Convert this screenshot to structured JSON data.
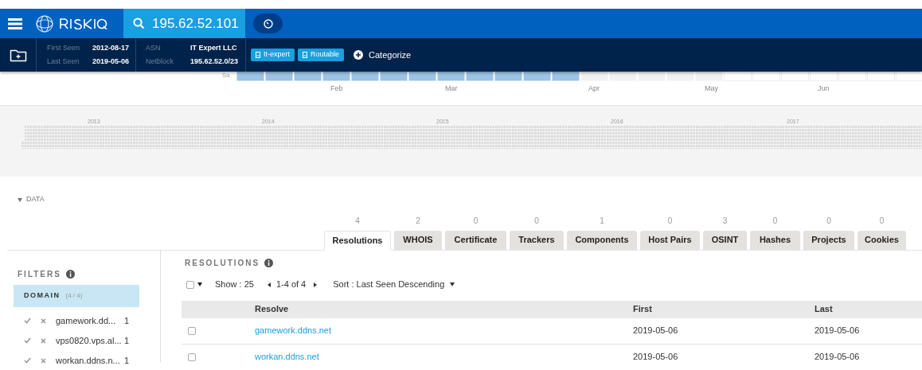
{
  "header": {
    "search_value": "195.62.52.101"
  },
  "summary": {
    "first_seen_label": "First Seen",
    "first_seen": "2012-08-17",
    "last_seen_label": "Last Seen",
    "last_seen": "2019-05-06",
    "asn_label": "ASN",
    "asn": "IT Expert LLC",
    "netblock_label": "Netblock",
    "netblock": "195.62.52.0/23",
    "tags": [
      "It-expert",
      "Routable"
    ],
    "categorize": "Categorize"
  },
  "calendar": {
    "day_label": "Sa",
    "months": [
      "Feb",
      "Mar",
      "Apr",
      "May",
      "Jun"
    ]
  },
  "timeline": {
    "years": [
      "2013",
      "2014",
      "2015",
      "2016",
      "2017"
    ]
  },
  "data_section": {
    "title": "DATA",
    "expanded": true
  },
  "tabs": [
    {
      "label": "Resolutions",
      "count": "4",
      "selected": true
    },
    {
      "label": "WHOIS",
      "count": "2",
      "selected": false
    },
    {
      "label": "Certificate",
      "count": "0",
      "selected": false
    },
    {
      "label": "Trackers",
      "count": "0",
      "selected": false
    },
    {
      "label": "Components",
      "count": "1",
      "selected": false
    },
    {
      "label": "Host Pairs",
      "count": "0",
      "selected": false
    },
    {
      "label": "OSINT",
      "count": "3",
      "selected": false
    },
    {
      "label": "Hashes",
      "count": "0",
      "selected": false
    },
    {
      "label": "Projects",
      "count": "0",
      "selected": false
    },
    {
      "label": "Cookies",
      "count": "0",
      "selected": false
    }
  ],
  "filters": {
    "title": "FILTERS",
    "group": {
      "label": "DOMAIN",
      "count": "(4 / 4)"
    },
    "items": [
      {
        "name": "gamework.dd...",
        "count": "1"
      },
      {
        "name": "vps0820.vps.al...",
        "count": "1"
      },
      {
        "name": "workan.ddns.n...",
        "count": "1"
      }
    ]
  },
  "resolutions": {
    "title": "RESOLUTIONS",
    "show": "Show : 25",
    "range": "1-4 of 4",
    "sort": "Sort : Last Seen Descending",
    "select_all_checked": false,
    "columns": [
      "Resolve",
      "First",
      "Last"
    ],
    "rows": [
      {
        "resolve": "gamework.ddns.net",
        "first": "2019-05-06",
        "last": "2019-05-06",
        "checked": false
      },
      {
        "resolve": "workan.ddns.net",
        "first": "2019-05-06",
        "last": "2019-05-06",
        "checked": false
      }
    ]
  }
}
